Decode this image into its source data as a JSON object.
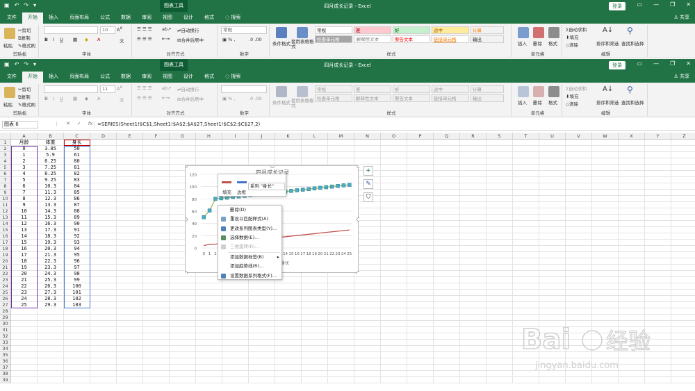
{
  "window": {
    "title": "四月成长记录 - Excel",
    "context_tab": "图表工具",
    "login": "登录",
    "share": "共享"
  },
  "tabs": [
    "文件",
    "开始",
    "插入",
    "页面布局",
    "公式",
    "数据",
    "审阅",
    "视图",
    "设计",
    "格式",
    "搜索"
  ],
  "ribbon": {
    "clipboard": {
      "paste": "粘贴",
      "cut": "剪切",
      "copy": "复制",
      "format_painter": "格式刷",
      "label": "剪贴板"
    },
    "font": {
      "size": "10",
      "size2": "11",
      "label": "字体"
    },
    "alignment": {
      "wrap": "自动换行",
      "merge": "合并后居中",
      "label": "对齐方式"
    },
    "number": {
      "format": "常规",
      "label": "数字"
    },
    "styles": {
      "conditional": "条件格式",
      "table": "套用表格格式",
      "label": "样式",
      "cells": [
        "常规",
        "差",
        "好",
        "适中",
        "计算",
        "检查单元格",
        "解释性文本",
        "警告文本",
        "链接单元格",
        "输出"
      ]
    },
    "cells": {
      "insert": "插入",
      "delete": "删除",
      "format": "格式",
      "label": "单元格"
    },
    "editing": {
      "autosum": "自动求和",
      "fill": "填充",
      "clear": "清除",
      "sort": "排序和筛选",
      "find": "查找和选择",
      "label": "编辑"
    }
  },
  "formula_bar": {
    "name_box": "图表 6",
    "formula": "=SERIES(Sheet1!$C$1,Sheet1!$A$2:$A$27,Sheet1!$C$2:$C$27,2)"
  },
  "columns": [
    "A",
    "B",
    "C",
    "D",
    "E",
    "F",
    "G",
    "H",
    "I",
    "J",
    "K",
    "L",
    "M",
    "N",
    "O",
    "P",
    "Q",
    "R",
    "S",
    "T",
    "U",
    "V",
    "W",
    "X",
    "Y",
    "Z"
  ],
  "rows": [
    "1",
    "2",
    "3",
    "4",
    "5",
    "6",
    "7",
    "8",
    "9",
    "10",
    "11",
    "12",
    "13",
    "14",
    "15",
    "16",
    "17",
    "18",
    "19",
    "20",
    "21",
    "22",
    "23",
    "24",
    "25",
    "26",
    "27",
    "28",
    "29",
    "30",
    "31",
    "32",
    "33",
    "34",
    "35",
    "36",
    "37",
    "38",
    "39"
  ],
  "table": {
    "headers": [
      "月龄",
      "体重",
      "身长"
    ],
    "months": [
      "0",
      "1",
      "2",
      "3",
      "4",
      "5",
      "6",
      "7",
      "8",
      "9",
      "10",
      "11",
      "12",
      "13",
      "14",
      "15",
      "16",
      "17",
      "18",
      "19",
      "20",
      "21",
      "22",
      "23",
      "24",
      "25"
    ],
    "weight": [
      "3.85",
      "5.9",
      "6.25",
      "7.25",
      "8.25",
      "9.25",
      "10.3",
      "11.3",
      "12.3",
      "13.3",
      "14.3",
      "15.3",
      "16.3",
      "17.3",
      "18.3",
      "19.3",
      "20.3",
      "21.3",
      "22.3",
      "23.3",
      "24.3",
      "25.3",
      "26.3",
      "27.3",
      "28.3",
      "29.3"
    ],
    "length": [
      "50",
      "61",
      "80",
      "81",
      "82",
      "83",
      "84",
      "85",
      "86",
      "87",
      "88",
      "89",
      "90",
      "91",
      "92",
      "93",
      "94",
      "95",
      "96",
      "97",
      "98",
      "99",
      "100",
      "101",
      "102",
      "103"
    ]
  },
  "chart_data": {
    "type": "line",
    "title": "四月成长记录",
    "categories": [
      "0",
      "1",
      "2",
      "3",
      "4",
      "5",
      "6",
      "7",
      "8",
      "9",
      "10",
      "11",
      "12",
      "13",
      "14",
      "15",
      "16",
      "17",
      "18",
      "19",
      "20",
      "21",
      "22",
      "23",
      "24",
      "25"
    ],
    "yticks": [
      "0",
      "20",
      "40",
      "60",
      "80",
      "100",
      "120"
    ],
    "ylim": [
      0,
      120
    ],
    "series": [
      {
        "name": "体重",
        "color": "#c0504d",
        "values": [
          3.85,
          5.9,
          6.25,
          7.25,
          8.25,
          9.25,
          10.3,
          11.3,
          12.3,
          13.3,
          14.3,
          15.3,
          16.3,
          17.3,
          18.3,
          19.3,
          20.3,
          21.3,
          22.3,
          23.3,
          24.3,
          25.3,
          26.3,
          27.3,
          28.3,
          29.3
        ]
      },
      {
        "name": "身长",
        "color": "#9bbb59",
        "values": [
          50,
          61,
          80,
          81,
          82,
          83,
          84,
          85,
          86,
          87,
          88,
          89,
          90,
          91,
          92,
          93,
          94,
          95,
          96,
          97,
          98,
          99,
          100,
          101,
          102,
          103
        ]
      }
    ],
    "legend_visible": [
      "身长"
    ],
    "legend": "bottom"
  },
  "mini_toolbar": {
    "fill": "填充",
    "outline": "边框",
    "series_select": "系列 \"身长\""
  },
  "context_menu": [
    {
      "label": "删除(D)",
      "enabled": true,
      "icon": ""
    },
    {
      "label": "重设以匹配样式(A)",
      "enabled": true,
      "icon": "#7aa0c8"
    },
    {
      "label": "更改系列图表类型(Y)...",
      "enabled": true,
      "icon": "#4f81bd"
    },
    {
      "label": "选择数据(E)...",
      "enabled": true,
      "icon": "#5b8f5b"
    },
    {
      "label": "三维旋转(R)...",
      "enabled": false,
      "icon": "#cfcfcf"
    },
    {
      "label": "添加数据标签(B)",
      "enabled": true,
      "icon": ""
    },
    {
      "label": "添加趋势线(R)...",
      "enabled": true,
      "icon": ""
    },
    {
      "label": "设置数据系列格式(F)...",
      "enabled": true,
      "icon": "#4f81bd"
    }
  ],
  "watermark": {
    "brand": "Bai",
    "brand2": "经验",
    "url": "jingyan.baidu.com"
  },
  "colors": {
    "excel_green": "#217346",
    "selection_blue": "#4472c4",
    "legend_line": "#9bbb59"
  }
}
